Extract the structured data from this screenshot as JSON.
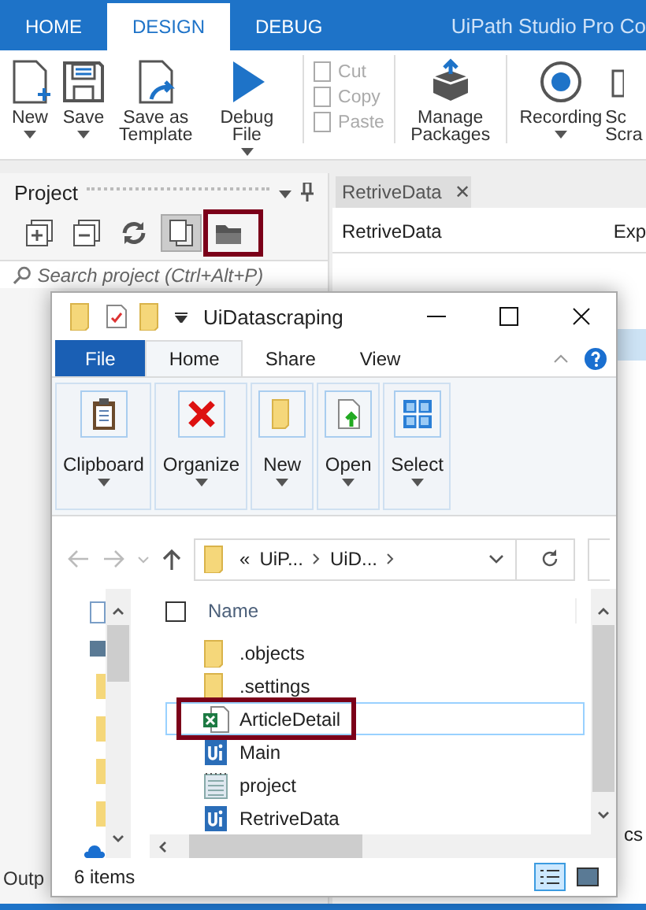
{
  "app_tabs": [
    {
      "label": "HOME",
      "selected": false
    },
    {
      "label": "DESIGN",
      "selected": true
    },
    {
      "label": "DEBUG",
      "selected": false
    }
  ],
  "app_title": "UiPath Studio Pro Co",
  "ribbon": [
    {
      "kind": "new",
      "label": "New",
      "caret": true
    },
    {
      "kind": "save",
      "label": "Save",
      "caret": true
    },
    {
      "kind": "template",
      "label": "Save as Template",
      "caret": false
    },
    {
      "kind": "debug",
      "label": "Debug File",
      "caret": true
    },
    {
      "kind": "edit",
      "items": [
        {
          "label": "Cut",
          "disabled": true
        },
        {
          "label": "Copy",
          "disabled": true
        },
        {
          "label": "Paste",
          "disabled": true
        }
      ]
    },
    {
      "kind": "packages",
      "label": "Manage Packages",
      "caret": false
    },
    {
      "kind": "record",
      "label": "Recording",
      "caret": true
    },
    {
      "kind": "scrape",
      "label": "Sc Scra",
      "caret": false
    }
  ],
  "project_panel": {
    "title": "Project",
    "tools": [
      {
        "kind": "expand",
        "selected": false,
        "highlighted": false
      },
      {
        "kind": "collapse",
        "selected": false,
        "highlighted": false
      },
      {
        "kind": "refresh",
        "selected": false,
        "highlighted": false
      },
      {
        "kind": "files",
        "selected": true,
        "highlighted": false
      },
      {
        "kind": "folder",
        "selected": false,
        "highlighted": true
      }
    ],
    "search": {
      "placeholder": "Search project (Ctrl+Alt+P)"
    }
  },
  "document": {
    "tab": "RetriveData",
    "close": "✕",
    "header": "RetriveData",
    "column_2": "Exp"
  },
  "output_label": "Outp",
  "right_edge_text": "cs",
  "explorer": {
    "title": "UiDatascraping",
    "tabs": [
      {
        "label": "File",
        "kind": "file",
        "selected": false
      },
      {
        "label": "Home",
        "kind": "tab",
        "selected": true
      },
      {
        "label": "Share",
        "kind": "tab",
        "selected": false
      },
      {
        "label": "View",
        "kind": "tab",
        "selected": false
      }
    ],
    "groups": [
      {
        "kind": "clipboard",
        "label": "Clipboard"
      },
      {
        "kind": "organize",
        "label": "Organize"
      },
      {
        "kind": "new",
        "label": "New"
      },
      {
        "kind": "open",
        "label": "Open"
      },
      {
        "kind": "select",
        "label": "Select"
      }
    ],
    "address_overflow": "«",
    "address": [
      "UiP...",
      "UiD..."
    ],
    "select_all": {
      "checked": false
    },
    "column": "Name",
    "files": [
      {
        "name": ".objects",
        "kind": "folder",
        "selected": false,
        "highlighted": false
      },
      {
        "name": ".settings",
        "kind": "folder",
        "selected": false,
        "highlighted": false
      },
      {
        "name": "ArticleDetail",
        "kind": "excel",
        "selected": true,
        "highlighted": true
      },
      {
        "name": "Main",
        "kind": "uipath",
        "selected": false,
        "highlighted": false
      },
      {
        "name": "project",
        "kind": "notes",
        "selected": false,
        "highlighted": false
      },
      {
        "name": "RetriveData",
        "kind": "uipath",
        "selected": false,
        "highlighted": false
      }
    ],
    "status": "6 items"
  }
}
